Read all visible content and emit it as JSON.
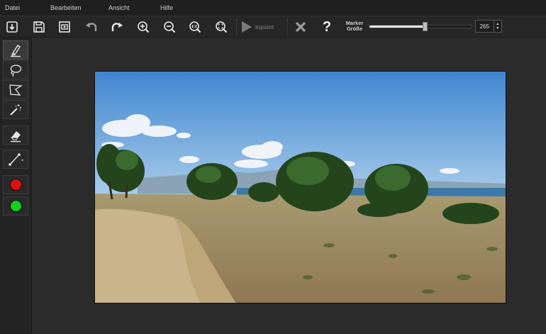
{
  "menu": {
    "items": [
      "Datei",
      "Bearbeiten",
      "Ansicht",
      "Hilfe"
    ]
  },
  "toolbar": {
    "inpaint_label": "Inpaint",
    "help_label": "?",
    "marker_label_line1": "Marker",
    "marker_label_line2": "Größe",
    "marker_size": "265",
    "marker_size_fraction": 0.54
  },
  "tools": {
    "marker": "marker-pen-icon",
    "lasso": "lasso-icon",
    "polygon": "polygon-lasso-icon",
    "magic_wand": "magic-wand-icon",
    "eraser": "eraser-icon",
    "line": "line-tool-icon"
  },
  "colors": {
    "red_marker": "#e01010",
    "green_marker": "#10d020",
    "accent": "#e6e6e6",
    "background": "#272727"
  }
}
